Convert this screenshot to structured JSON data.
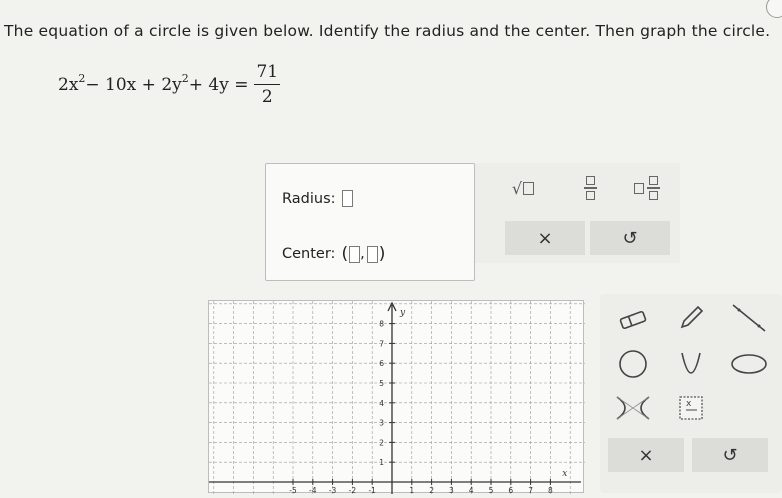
{
  "question": {
    "prompt": "The equation of a circle is given below. Identify the radius and the center. Then graph the circle.",
    "equation": {
      "lhs_parts": [
        "2x",
        "2",
        " − 10x + 2y",
        "2",
        " + 4y ="
      ],
      "rhs_numerator": "71",
      "rhs_denominator": "2"
    }
  },
  "answer": {
    "radius_label": "Radius:",
    "center_label": "Center:",
    "center_open": "(",
    "center_comma": ",",
    "center_close": ")"
  },
  "math_tools": {
    "icons": [
      "sqrt-icon",
      "fraction-icon",
      "mixed-number-icon"
    ],
    "clear_label": "×",
    "undo_label": "↺"
  },
  "graph": {
    "x_axis_label": "x",
    "y_axis_label": "y",
    "x_tick_labels": [
      "-5",
      "-4",
      "-3",
      "-2",
      "-1",
      "1",
      "2",
      "3",
      "4",
      "5",
      "6",
      "7",
      "8"
    ],
    "y_tick_labels": [
      "1",
      "2",
      "3",
      "4",
      "5",
      "6",
      "7",
      "8"
    ],
    "x_ticks": [
      -5,
      -4,
      -3,
      -2,
      -1,
      1,
      2,
      3,
      4,
      5,
      6,
      7,
      8
    ],
    "y_ticks": [
      1,
      2,
      3,
      4,
      5,
      6,
      7,
      8
    ]
  },
  "drawing_tools": {
    "icons": [
      "eraser-icon",
      "pencil-icon",
      "line-icon",
      "circle-icon",
      "parabola-icon",
      "ellipse-icon",
      "hyperbola-icon",
      "inequality-icon"
    ],
    "clear_label": "×",
    "undo_label": "↺"
  }
}
